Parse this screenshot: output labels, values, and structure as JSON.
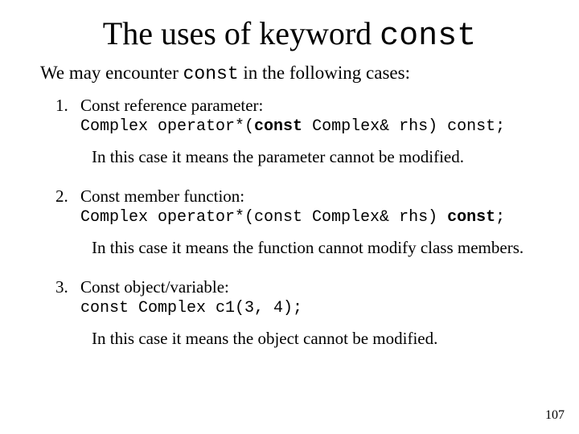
{
  "title_prefix": "The uses of keyword ",
  "title_kw": "const",
  "intro_a": "We may encounter ",
  "intro_kw": "const",
  "intro_b": " in the following cases:",
  "item1": {
    "label": "Const reference parameter:",
    "code_a": "Complex operator*(",
    "code_bold": "const",
    "code_b": " Complex& rhs) const;",
    "explain": "In this case it means the parameter cannot be modified."
  },
  "item2": {
    "label": "Const member function:",
    "code_a": "Complex operator*(const Complex& rhs) ",
    "code_bold": "const",
    "code_b": ";",
    "explain": "In this case it means the function cannot modify class members."
  },
  "item3": {
    "label": "Const object/variable:",
    "code": "const Complex c1(3, 4);",
    "explain": "In this case it means the object cannot be modified."
  },
  "page_number": "107"
}
